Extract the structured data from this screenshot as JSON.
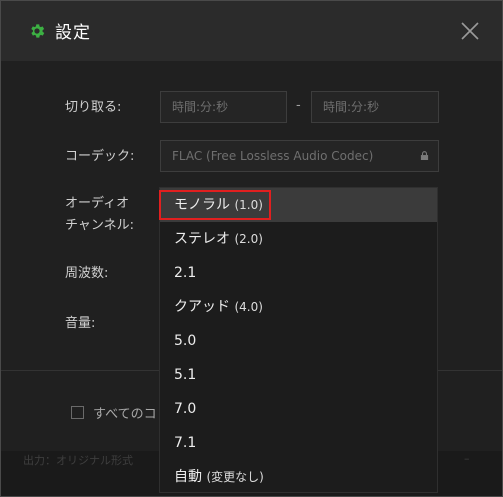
{
  "dialog": {
    "title": "設定",
    "accent_color": "#3cb043"
  },
  "form": {
    "cut_label": "切り取る:",
    "start_placeholder": "時間:分:秒",
    "separator": "-",
    "end_placeholder": "時間:分:秒",
    "codec_label": "コーデック:",
    "codec_value": "FLAC (Free Lossless Audio Codec)",
    "channel_label_line1": "オーディオ",
    "channel_label_line2": "チャンネル:",
    "frequency_label": "周波数:",
    "volume_label": "音量:"
  },
  "options": {
    "checkbox_label": "すべてのコ",
    "footer_text": "出力：オリジナル形式",
    "footer_right": "–"
  },
  "dropdown": {
    "selected_index": 0,
    "items": [
      {
        "main": "モノラル",
        "paren": "(1.0)"
      },
      {
        "main": "ステレオ",
        "paren": "(2.0)"
      },
      {
        "main": "2.1",
        "paren": ""
      },
      {
        "main": "クアッド",
        "paren": "(4.0)"
      },
      {
        "main": "5.0",
        "paren": ""
      },
      {
        "main": "5.1",
        "paren": ""
      },
      {
        "main": "7.0",
        "paren": ""
      },
      {
        "main": "7.1",
        "paren": ""
      },
      {
        "main": "自動",
        "paren": "(変更なし)"
      }
    ]
  }
}
